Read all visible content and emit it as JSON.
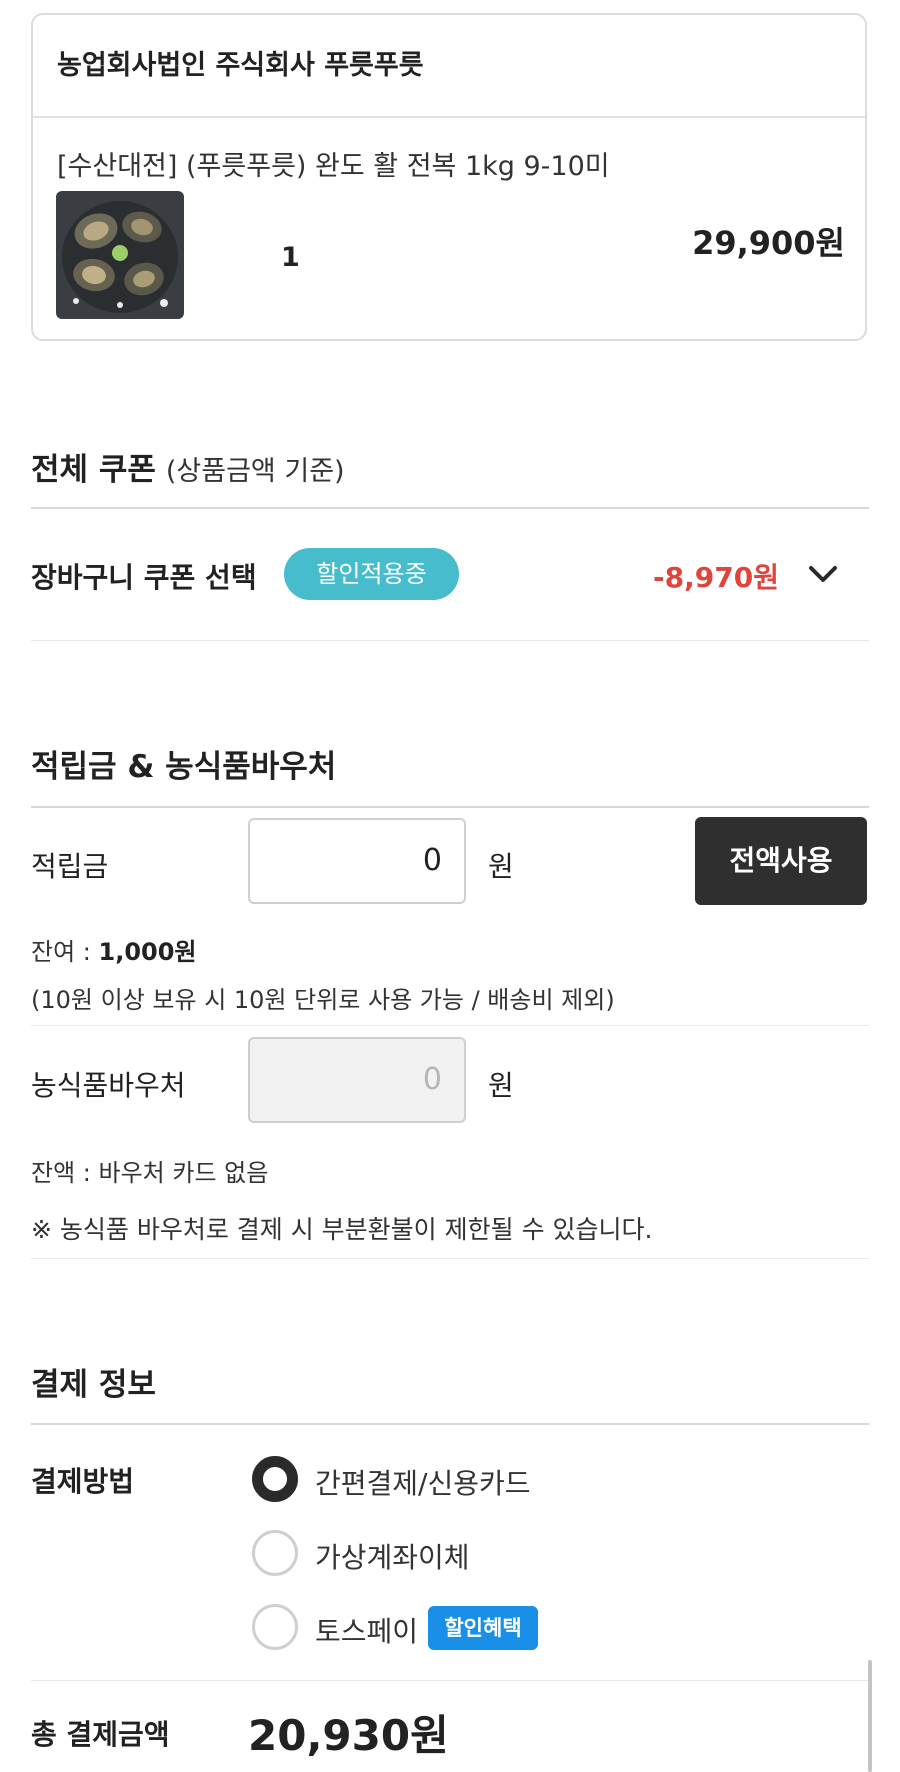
{
  "seller": {
    "name": "농업회사법인 주식회사 푸릇푸릇"
  },
  "product": {
    "name": "[수산대전] (푸릇푸릇) 완도 활 전복 1kg 9-10미",
    "quantity": "1",
    "price": "29,900원"
  },
  "coupon_section": {
    "title": "전체 쿠폰",
    "subtitle": "(상품금액 기준)",
    "row_label": "장바구니 쿠폰 선택",
    "badge": "할인적용중",
    "amount": "-8,970원",
    "accent_color": "#47bccc",
    "discount_color": "#e0443a"
  },
  "points_section": {
    "title": "적립금 & 농식품바우처",
    "points_label": "적립금",
    "points_value": "0",
    "unit": "원",
    "use_all_button": "전액사용",
    "balance_prefix": "잔여 : ",
    "balance_value": "1,000원",
    "points_note": "(10원 이상 보유 시 10원 단위로 사용 가능 / 배송비 제외)",
    "voucher_label": "농식품바우처",
    "voucher_value": "0",
    "voucher_balance": "잔액 : 바우처 카드 없음",
    "voucher_note": "※ 농식품 바우처로 결제 시 부분환불이 제한될 수 있습니다."
  },
  "payment_section": {
    "title": "결제 정보",
    "method_label": "결제방법",
    "methods": [
      {
        "label": "간편결제/신용카드",
        "selected": true
      },
      {
        "label": "가상계좌이체",
        "selected": false
      },
      {
        "label": "토스페이",
        "selected": false
      }
    ],
    "toss_badge": "할인혜택",
    "toss_badge_color": "#1a8fe8",
    "total_label": "총 결제금액",
    "total_amount": "20,930원"
  }
}
